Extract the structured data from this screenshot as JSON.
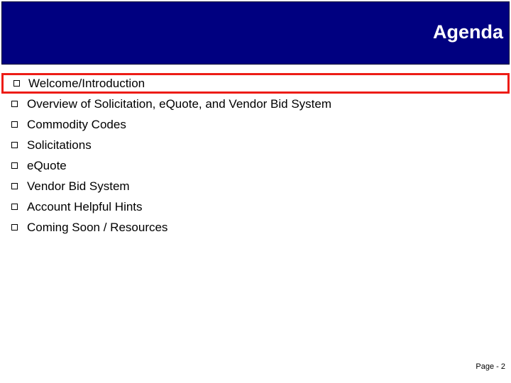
{
  "slide": {
    "title": "Agenda",
    "title_banner_color": "#000080",
    "title_text_color": "#FFFFFF",
    "background_color": "#FFFFFF",
    "highlight_color": "#ED1C16",
    "bullet_glyph": "hollow-square"
  },
  "agenda": {
    "items": [
      {
        "label": "Welcome/Introduction",
        "highlighted": true
      },
      {
        "label": "Overview of Solicitation, eQuote, and Vendor Bid System",
        "highlighted": false
      },
      {
        "label": "Commodity Codes",
        "highlighted": false
      },
      {
        "label": "Solicitations",
        "highlighted": false
      },
      {
        "label": "eQuote",
        "highlighted": false
      },
      {
        "label": "Vendor Bid System",
        "highlighted": false
      },
      {
        "label": "Account Helpful Hints",
        "highlighted": false
      },
      {
        "label": "Coming Soon / Resources",
        "highlighted": false
      }
    ]
  },
  "footer": {
    "page_label": "Page - 2"
  }
}
